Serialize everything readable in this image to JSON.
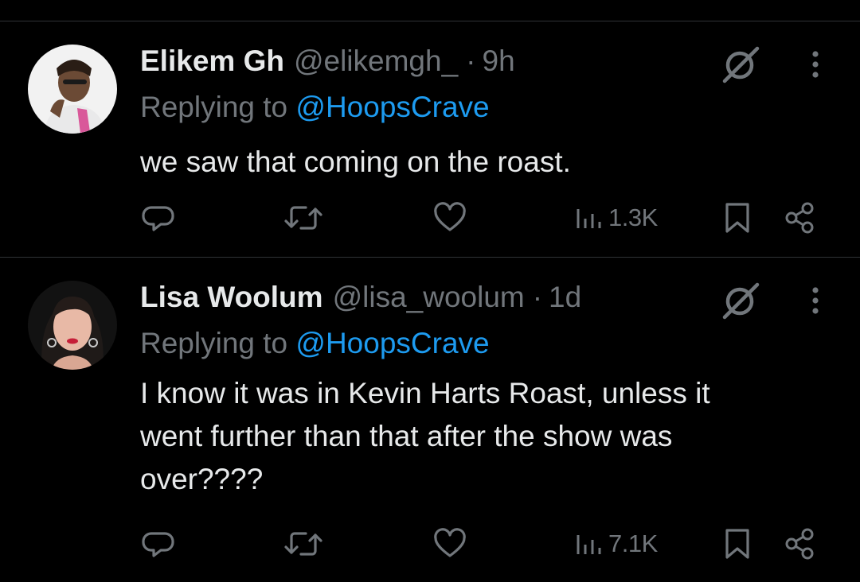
{
  "tweets": [
    {
      "display_name": "Elikem Gh",
      "handle": "@elikemgh_",
      "separator": "·",
      "time": "9h",
      "replying_prefix": "Replying to ",
      "replying_to": "@HoopsCrave",
      "text": "we saw that coming on the roast.",
      "views": "1.3K"
    },
    {
      "display_name": "Lisa Woolum",
      "handle": "@lisa_woolum",
      "separator": "·",
      "time": "1d",
      "replying_prefix": "Replying to ",
      "replying_to": "@HoopsCrave",
      "text": "I know it was in Kevin Harts Roast, unless it\nwent further than that after the show was\nover????",
      "views": "7.1K"
    }
  ],
  "icons": {
    "reply": "reply-icon",
    "retweet": "retweet-icon",
    "like": "heart-icon",
    "views": "views-icon",
    "bookmark": "bookmark-icon",
    "share": "share-icon",
    "grok": "grok-icon",
    "more": "more-icon"
  },
  "colors": {
    "background": "#000000",
    "text_primary": "#e7e9ea",
    "text_secondary": "#71767b",
    "accent": "#1d9bf0",
    "divider": "#2f3336"
  }
}
